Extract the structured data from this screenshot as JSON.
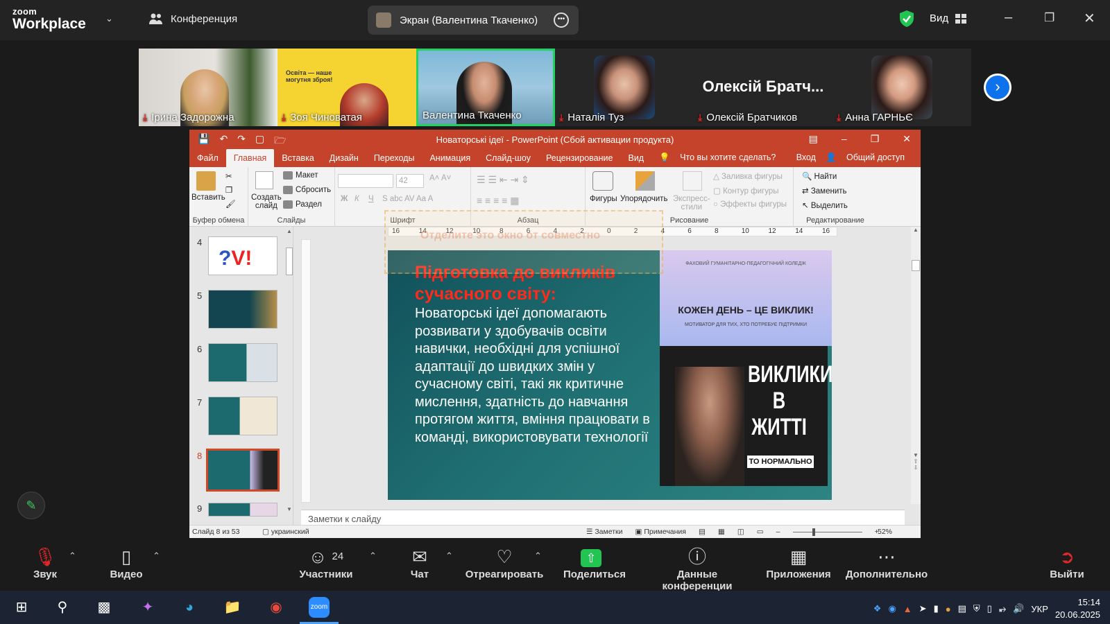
{
  "zoom": {
    "logo_line1": "zoom",
    "logo_line2": "Workplace",
    "meeting_tab": "Конференция",
    "share_tab": "Экран (Валентина Ткаченко)",
    "view_label": "Вид",
    "accent_color": "#0e72ed"
  },
  "gallery": {
    "participants": [
      {
        "name": "Ірина Задорожна",
        "muted": true
      },
      {
        "name": "Зоя Чиноватая",
        "muted": true
      },
      {
        "name": "Валентина Ткаченко",
        "muted": false,
        "active_speaker": true
      },
      {
        "name": "Наталія Туз",
        "muted": true
      },
      {
        "name": "Олексій Братчиков",
        "muted": true,
        "tile_text": "Олексій Братч..."
      },
      {
        "name": "Анна ГАРНЬЄ",
        "muted": true
      }
    ],
    "tile_texts": {
      "zoya_line1": "Освіта — наше",
      "zoya_line2": "могутня зброя!"
    }
  },
  "ppt": {
    "window_title": "Новаторські ідеї - PowerPoint (Сбой активации продукта)",
    "menu": [
      "Файл",
      "Главная",
      "Вставка",
      "Дизайн",
      "Переходы",
      "Анимация",
      "Слайд-шоу",
      "Рецензирование",
      "Вид",
      "Что вы хотите сделать?"
    ],
    "menu_right": [
      "Вход",
      "Общий доступ"
    ],
    "ribbon": {
      "paste": "Вставить",
      "clipboard_group": "Буфер обмена",
      "create_slide": "Создать",
      "create_slide2": "слайд",
      "layout": "Макет",
      "reset": "Сбросить",
      "section": "Раздел",
      "slides_group": "Слайды",
      "font_size": "42",
      "font_group": "Шрифт",
      "para_group": "Абзац",
      "shapes": "Фигуры",
      "arrange": "Упорядочить",
      "express": "Экспресс-",
      "express2": "стили",
      "fill": "Заливка фигуры",
      "outline": "Контур фигуры",
      "effects": "Эффекты фигуры",
      "drawing_group": "Рисование",
      "find": "Найти",
      "replace": "Заменить",
      "select": "Выделить",
      "editing_group": "Редактирование",
      "ghost_text": "Отделите это окно от совместно"
    },
    "ruler_ticks": [
      "16",
      "14",
      "12",
      "10",
      "8",
      "6",
      "4",
      "2",
      "0",
      "2",
      "4",
      "6",
      "8",
      "10",
      "12",
      "14",
      "16"
    ],
    "thumbs": [
      {
        "num": "4"
      },
      {
        "num": "5"
      },
      {
        "num": "6"
      },
      {
        "num": "7"
      },
      {
        "num": "8",
        "selected": true
      },
      {
        "num": "9"
      }
    ],
    "slide": {
      "title": "Підготовка до викликів сучасного світу:",
      "body": "Новаторські ідеї допомагають розвивати у здобувачів освіти навички, необхідні для успішної адаптації до швидких змін у сучасному світі, такі як критичне мислення, здатність до навчання протягом життя, вміння працювати в команді, використовувати технології",
      "img_top_small": "ФАХОВИЙ ГУМАНІТАРНО-ПЕДАГОГІЧНИЙ КОЛЕДЖ",
      "img_headline": "КОЖЕН ДЕНЬ – ЦЕ ВИКЛИК!",
      "img_sub": "МОТИВАТОР ДЛЯ ТИХ, ХТО ПОТРЕБУЄ ПІДТРИМКИ",
      "img_big": "ВИКЛИКИ В ЖИТТІ",
      "img_tag": "ТО НОРМАЛЬНО",
      "title_color": "#ff2a1a"
    },
    "notes_placeholder": "Заметки к слайду",
    "status": {
      "slide_of": "Слайд 8 из 53",
      "language": "украинский",
      "notes": "Заметки",
      "comments": "Примечания",
      "zoom": "52%"
    }
  },
  "controls": {
    "sound": "Звук",
    "video": "Видео",
    "participants": "Участники",
    "participants_count": "24",
    "chat": "Чат",
    "react": "Отреагировать",
    "share": "Поделиться",
    "meeting_info": "Данные конференции",
    "apps": "Приложения",
    "more": "Дополнительно",
    "leave": "Выйти"
  },
  "taskbar": {
    "lang": "УКР",
    "time": "15:14",
    "date": "20.06.2025"
  }
}
